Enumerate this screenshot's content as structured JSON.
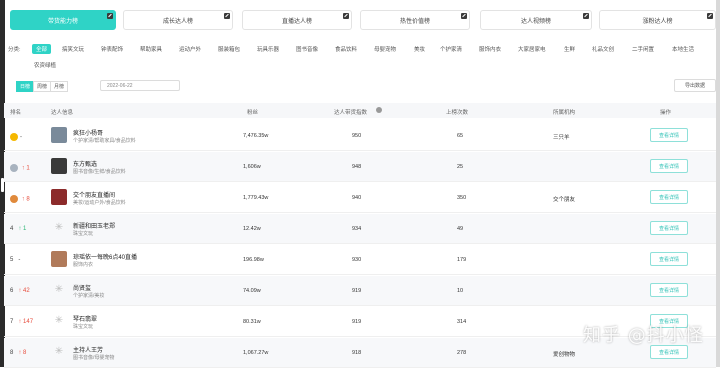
{
  "tabs": [
    {
      "label": "带货能力榜",
      "active": true
    },
    {
      "label": "成长达人榜",
      "active": false
    },
    {
      "label": "直播达人榜",
      "active": false
    },
    {
      "label": "热性价值榜",
      "active": false
    },
    {
      "label": "达人视频榜",
      "active": false
    },
    {
      "label": "涨粉达人榜",
      "active": false
    }
  ],
  "category_label": "分类:",
  "categories": [
    "全部",
    "搞笑文玩",
    "钟表配饰",
    "帮助家具",
    "运动户外",
    "服装箱包",
    "玩具乐器",
    "图书音像",
    "食品饮料",
    "母婴宠物",
    "美妆",
    "个护家清",
    "服饰内衣",
    "大家居家电",
    "生鲜",
    "礼品文创",
    "二手闲置",
    "本地生活"
  ],
  "categories_row2": "农资绿植",
  "period": {
    "day": "日榜",
    "week": "周榜",
    "month": "月榜"
  },
  "date": "2022-06-22",
  "export_label": "导出数据",
  "columns": {
    "rank": "排名",
    "info": "达人信息",
    "fans": "粉丝",
    "score": "达人带货指数",
    "rank_count": "上榜次数",
    "institution": "所属机构",
    "action": "操作"
  },
  "view_label": "查看详情",
  "rows": [
    {
      "rank": "-",
      "change": "",
      "name": "疯狂小杨哥",
      "cat": "个护家清/帮助家具/食品饮料",
      "fans": "7,476.35w",
      "score": "950",
      "count": "65",
      "inst": "三只羊",
      "medal": "#f5b800",
      "avatar": "#7a8a9a"
    },
    {
      "rank": "",
      "change": "↑ 1",
      "name": "东方甄选",
      "cat": "图书音像/生鲜/食品饮料",
      "fans": "1,606w",
      "score": "948",
      "count": "25",
      "inst": "",
      "medal": "#a8b3bf",
      "avatar": "#3a3a3a"
    },
    {
      "rank": "",
      "change": "↑ 8",
      "name": "交个朋友直播间",
      "cat": "美妆/运动户外/食品饮料",
      "fans": "1,779.43w",
      "score": "940",
      "count": "350",
      "inst": "交个朋友",
      "medal": "#e08a3c",
      "avatar": "#8c2b2b"
    },
    {
      "rank": "4",
      "change": "↑ 1",
      "name": "新疆和田玉老郑",
      "cat": "珠宝文玩",
      "fans": "12.42w",
      "score": "934",
      "count": "49",
      "inst": "",
      "medal": "",
      "avatar": ""
    },
    {
      "rank": "5",
      "change": "-",
      "name": "琼瑶依一每晚6点40直播",
      "cat": "服饰内衣",
      "fans": "196.98w",
      "score": "930",
      "count": "179",
      "inst": "",
      "medal": "",
      "avatar": "#b07a5a"
    },
    {
      "rank": "6",
      "change": "↑ 42",
      "name": "尚贤玺",
      "cat": "个护家清/美妆",
      "fans": "74.09w",
      "score": "919",
      "count": "10",
      "inst": "",
      "medal": "",
      "avatar": ""
    },
    {
      "rank": "7",
      "change": "↑ 147",
      "name": "琴石翡翠",
      "cat": "珠宝文玩",
      "fans": "80.31w",
      "score": "919",
      "count": "314",
      "inst": "",
      "medal": "",
      "avatar": ""
    },
    {
      "rank": "8",
      "change": "↑ 8",
      "name": "主持人王芳",
      "cat": "图书音像/母婴宠物",
      "fans": "1,067.27w",
      "score": "918",
      "count": "278",
      "inst": "爱创物物",
      "medal": "",
      "avatar": ""
    }
  ],
  "watermark": "知乎 @抖小怪"
}
